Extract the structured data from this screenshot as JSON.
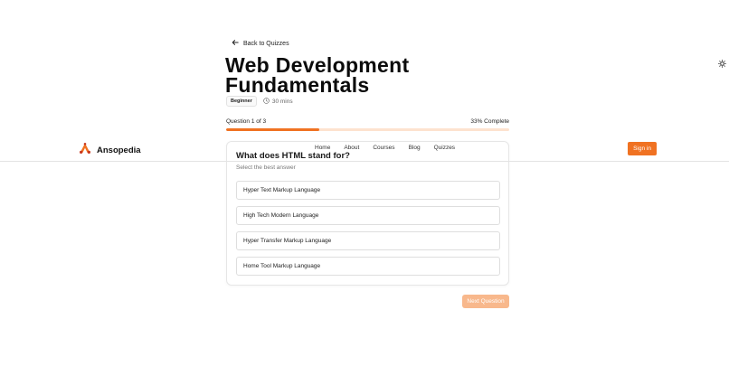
{
  "back_link": {
    "label": "Back to Quizzes",
    "icon": "arrow-left-icon"
  },
  "theme_toggle": {
    "icon": "sun-icon"
  },
  "quiz": {
    "title": "Web Development Fundamentals",
    "level": "Beginner",
    "duration": "30 mins",
    "progress": {
      "label": "Question 1 of 3",
      "percent_label": "33% Complete",
      "fraction": 0.33
    },
    "question": "What does HTML stand for?",
    "hint": "Select the best answer",
    "options": [
      "Hyper Text Markup Language",
      "High Tech Modern Language",
      "Hyper Transfer Markup Language",
      "Home Tool Markup Language"
    ],
    "next_label": "Next Question"
  },
  "header": {
    "brand": "Ansopedia",
    "nav": [
      "Home",
      "About",
      "Courses",
      "Blog",
      "Quizzes"
    ],
    "signin_label": "Sign in"
  },
  "colors": {
    "accent": "#f07222",
    "accent_light": "#fde2cf",
    "disabled_button": "#f8b88c"
  }
}
